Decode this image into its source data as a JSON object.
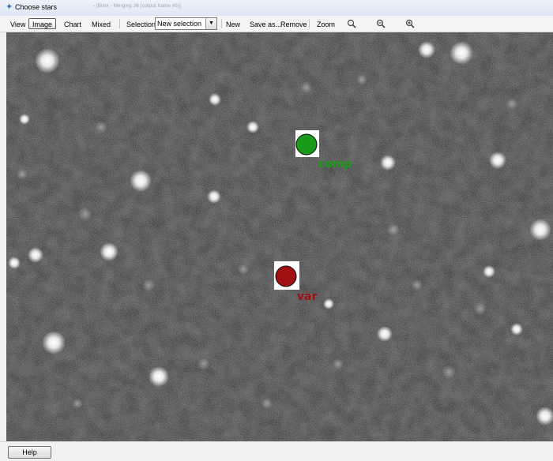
{
  "window": {
    "title": "Choose stars",
    "subtitle": "- [Blink - Merging 36 (output frame #5)]"
  },
  "toolbar": {
    "view_label": "View",
    "image_label": "Image",
    "chart_label": "Chart",
    "mixed_label": "Mixed",
    "selection_label": "Selection",
    "selection_value": "New selection",
    "new_label": "New",
    "saveas_label": "Save as...",
    "remove_label": "Remove",
    "zoom_label": "Zoom",
    "active_mode": "Image"
  },
  "markers": {
    "comp": {
      "label": "comp",
      "color": "#1a9a1a"
    },
    "var": {
      "label": "var",
      "color": "#a01010"
    }
  },
  "footer": {
    "help_label": "Help"
  },
  "icons": [
    "app-star-icon",
    "zoom-fit-icon",
    "zoom-out-icon",
    "zoom-in-icon",
    "dropdown-arrow-icon"
  ]
}
